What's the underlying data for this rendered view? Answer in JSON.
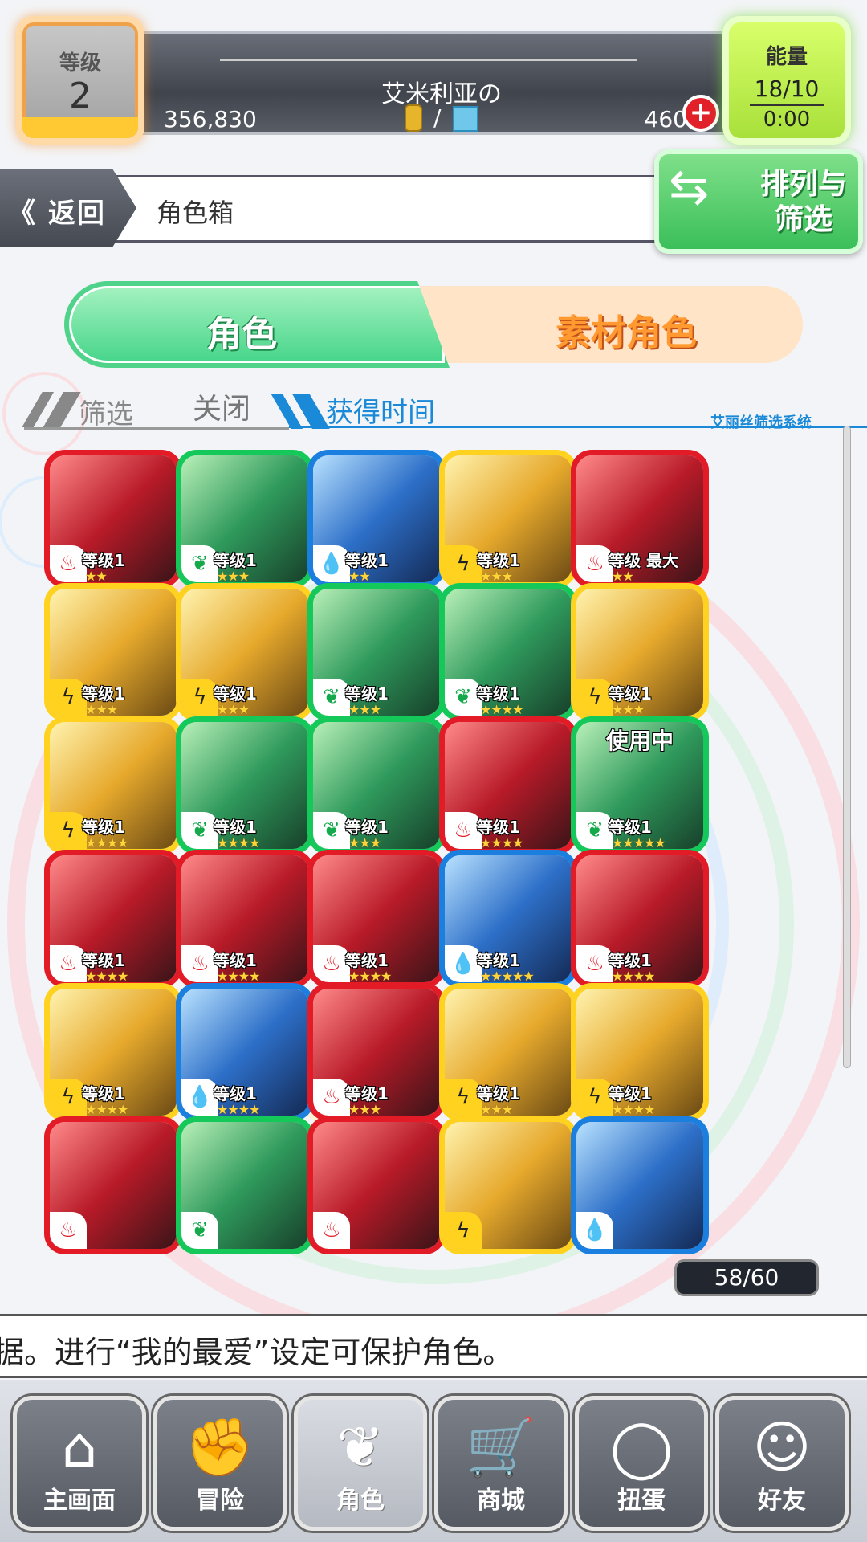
{
  "header": {
    "level_label": "等级",
    "level_value": "2",
    "player_name": "艾米利亚の",
    "coins": "356,830",
    "gems": "460",
    "currency_sep": "/",
    "add_button": "+",
    "energy_label": "能量",
    "energy_value": "18/10",
    "energy_timer": "0:00"
  },
  "nav": {
    "back_label": "返回",
    "title": "角色箱",
    "sort_label": "排列与筛选"
  },
  "tabs": {
    "tab1": "角色",
    "tab2": "素材角色"
  },
  "filter": {
    "label": "筛选",
    "state": "关闭",
    "sort_by": "获得时间",
    "system_label": "艾丽丝筛选系统"
  },
  "cards": [
    {
      "color": "red",
      "element": "fire",
      "level": "等级1",
      "stars": "★★"
    },
    {
      "color": "green",
      "element": "wood",
      "level": "等级1",
      "stars": "★★★"
    },
    {
      "color": "blue",
      "element": "water",
      "level": "等级1",
      "stars": "★★"
    },
    {
      "color": "yellow",
      "element": "thunder",
      "level": "等级1",
      "stars": "★★★"
    },
    {
      "color": "red",
      "element": "fire",
      "level": "等级 最大",
      "stars": "★★"
    },
    {
      "color": "yellow",
      "element": "thunder",
      "level": "等级1",
      "stars": "★★★"
    },
    {
      "color": "yellow",
      "element": "thunder",
      "level": "等级1",
      "stars": "★★★"
    },
    {
      "color": "green",
      "element": "wood",
      "level": "等级1",
      "stars": "★★★"
    },
    {
      "color": "green",
      "element": "wood",
      "level": "等级1",
      "stars": "★★★★"
    },
    {
      "color": "yellow",
      "element": "thunder",
      "level": "等级1",
      "stars": "★★★"
    },
    {
      "color": "yellow",
      "element": "thunder",
      "level": "等级1",
      "stars": "★★★★"
    },
    {
      "color": "green",
      "element": "wood",
      "level": "等级1",
      "stars": "★★★★"
    },
    {
      "color": "green",
      "element": "wood",
      "level": "等级1",
      "stars": "★★★"
    },
    {
      "color": "red",
      "element": "fire",
      "level": "等级1",
      "stars": "★★★★"
    },
    {
      "color": "green",
      "element": "wood",
      "level": "等级1",
      "stars": "★★★★★",
      "in_use": "使用中"
    },
    {
      "color": "red",
      "element": "fire",
      "level": "等级1",
      "stars": "★★★★"
    },
    {
      "color": "red",
      "element": "fire",
      "level": "等级1",
      "stars": "★★★★"
    },
    {
      "color": "red",
      "element": "fire",
      "level": "等级1",
      "stars": "★★★★"
    },
    {
      "color": "blue",
      "element": "water",
      "level": "等级1",
      "stars": "★★★★★"
    },
    {
      "color": "red",
      "element": "fire",
      "level": "等级1",
      "stars": "★★★★"
    },
    {
      "color": "yellow",
      "element": "thunder",
      "level": "等级1",
      "stars": "★★★★"
    },
    {
      "color": "blue",
      "element": "water",
      "level": "等级1",
      "stars": "★★★★"
    },
    {
      "color": "red",
      "element": "fire",
      "level": "等级1",
      "stars": "★★★"
    },
    {
      "color": "yellow",
      "element": "thunder",
      "level": "等级1",
      "stars": "★★★"
    },
    {
      "color": "yellow",
      "element": "thunder",
      "level": "等级1",
      "stars": "★★★★"
    },
    {
      "color": "red",
      "element": "fire",
      "level": "",
      "stars": ""
    },
    {
      "color": "green",
      "element": "wood",
      "level": "",
      "stars": ""
    },
    {
      "color": "red",
      "element": "fire",
      "level": "",
      "stars": ""
    },
    {
      "color": "yellow",
      "element": "thunder",
      "level": "",
      "stars": ""
    },
    {
      "color": "blue",
      "element": "water",
      "level": "",
      "stars": ""
    }
  ],
  "counter": "58/60",
  "ticker": "据。进行“我的最爱”设定可保护角色。",
  "bottom_nav": [
    {
      "label": "主画面",
      "icon": "home-icon",
      "glyph": "⌂"
    },
    {
      "label": "冒险",
      "icon": "handshake-icon",
      "glyph": "✊"
    },
    {
      "label": "角色",
      "icon": "rabbit-icon",
      "glyph": "❦"
    },
    {
      "label": "商城",
      "icon": "cart-icon",
      "glyph": "🛒"
    },
    {
      "label": "扭蛋",
      "icon": "egg-icon",
      "glyph": "◯"
    },
    {
      "label": "好友",
      "icon": "friends-icon",
      "glyph": "☺"
    }
  ],
  "colors": {
    "red": "#e21b26",
    "green": "#14c95a",
    "blue": "#1b7fe0",
    "yellow": "#ffd21f",
    "accent_blue": "#1a8ad8"
  }
}
